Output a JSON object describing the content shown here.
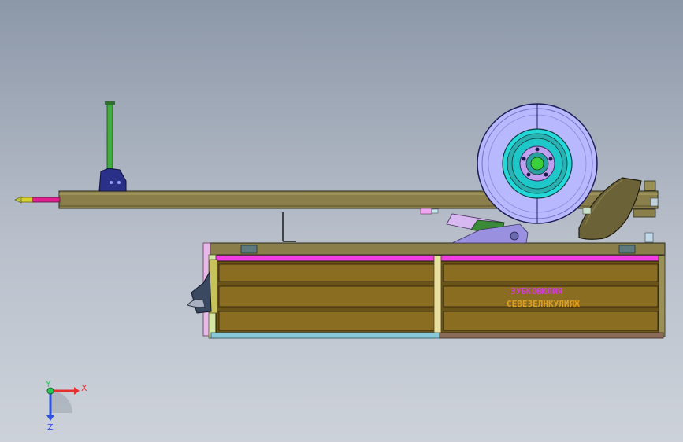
{
  "viewport": {
    "background_top": "#8c97a8",
    "background_bottom": "#cdd2da"
  },
  "model": {
    "box_label_top": "ЗУБКОВЮЛИЯ",
    "box_label_bottom": "СЕВЕЗЕЛНКУЛИЯЖ"
  },
  "triad": {
    "x_label": "X",
    "y_label": "Y",
    "z_label": "Z",
    "x_color": "#e53030",
    "y_color": "#22cc55",
    "z_color": "#3050e0"
  },
  "colors": {
    "drawbar": "#8a7f4a",
    "box_panel": "#6a5418",
    "box_trim": "#ef3fe0",
    "wheel_tire": "#b8b8ff",
    "wheel_rim": "#22d8d8",
    "jack_green": "#3fae3f",
    "fender": "#6b6238"
  }
}
